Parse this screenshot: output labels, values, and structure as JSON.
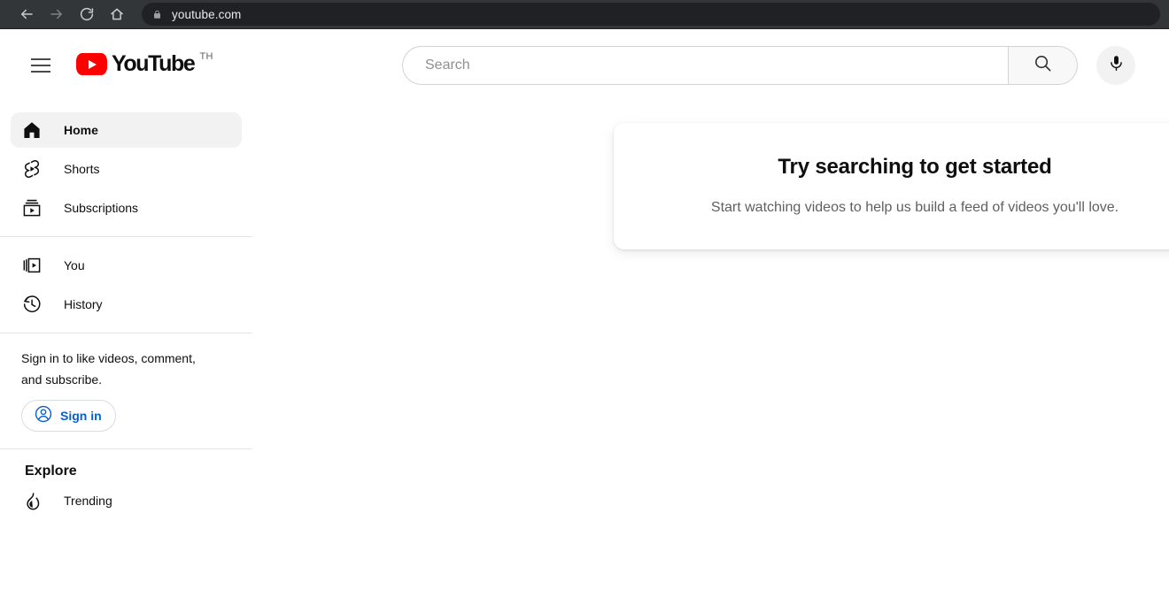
{
  "browser": {
    "back_icon": "arrow-left-icon",
    "forward_icon": "arrow-right-icon",
    "reload_icon": "reload-icon",
    "home_icon": "home-icon",
    "lock_icon": "lock-icon",
    "url": "youtube.com"
  },
  "masthead": {
    "menu_icon": "hamburger-menu-icon",
    "logo_text": "YouTube",
    "logo_country": "TH",
    "search": {
      "placeholder": "Search",
      "value": "",
      "submit_icon": "search-icon",
      "voice_icon": "microphone-icon"
    }
  },
  "sidebar": {
    "primary": [
      {
        "label": "Home",
        "icon": "house-icon",
        "active": true
      },
      {
        "label": "Shorts",
        "icon": "shorts-icon",
        "active": false
      },
      {
        "label": "Subscriptions",
        "icon": "subscriptions-icon",
        "active": false
      }
    ],
    "secondary": [
      {
        "label": "You",
        "icon": "library-icon",
        "active": false
      },
      {
        "label": "History",
        "icon": "history-clock-icon",
        "active": false
      }
    ],
    "signin": {
      "prompt": "Sign in to like videos, comment, and subscribe.",
      "button_label": "Sign in",
      "button_icon": "account-circle-icon",
      "accent_color": "#065fd4"
    },
    "explore": {
      "heading": "Explore",
      "items": [
        {
          "label": "Trending",
          "icon": "flame-icon",
          "active": false
        }
      ]
    }
  },
  "content": {
    "promo": {
      "title": "Try searching to get started",
      "subtitle": "Start watching videos to help us build a feed of videos you'll love."
    }
  },
  "colors": {
    "brand_red": "#ff0000",
    "chrome_bg": "#323639",
    "urlbar_bg": "#202124",
    "page_bg": "#ffffff",
    "accent_blue": "#065fd4"
  }
}
